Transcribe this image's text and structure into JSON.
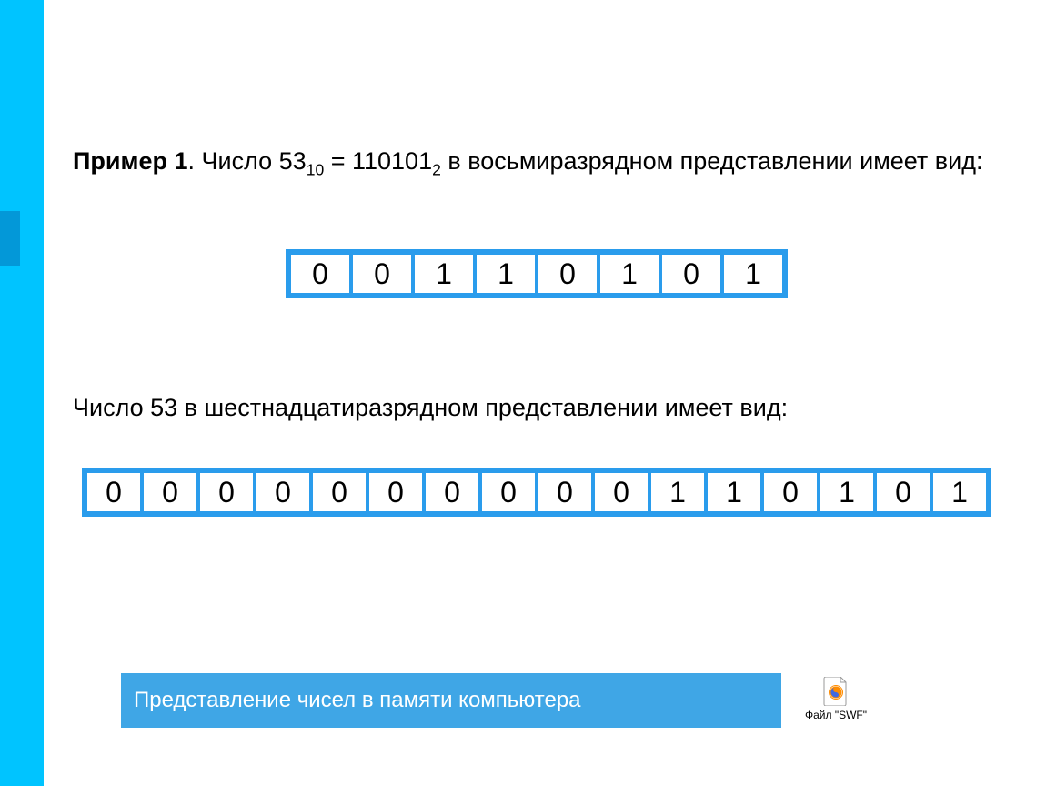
{
  "paragraph1": {
    "bold_prefix": "Пример 1",
    "text_before_num": ". Число 53",
    "sub1": "10",
    "text_mid": " = 110101",
    "sub2": "2",
    "text_after": " в восьмиразрядном представлении имеет вид:"
  },
  "bits8": [
    "0",
    "0",
    "1",
    "1",
    "0",
    "1",
    "0",
    "1"
  ],
  "paragraph2": "Число 53 в шестнадцатиразрядном представлении имеет вид:",
  "bits16": [
    "0",
    "0",
    "0",
    "0",
    "0",
    "0",
    "0",
    "0",
    "0",
    "0",
    "1",
    "1",
    "0",
    "1",
    "0",
    "1"
  ],
  "footer_title": "Представление чисел в памяти компьютера",
  "file_label": "Файл \"SWF\"",
  "colors": {
    "accent": "#2a9cec",
    "stripe": "#00c4ff",
    "notch": "#0398d8",
    "footer": "#3fa6e6"
  }
}
